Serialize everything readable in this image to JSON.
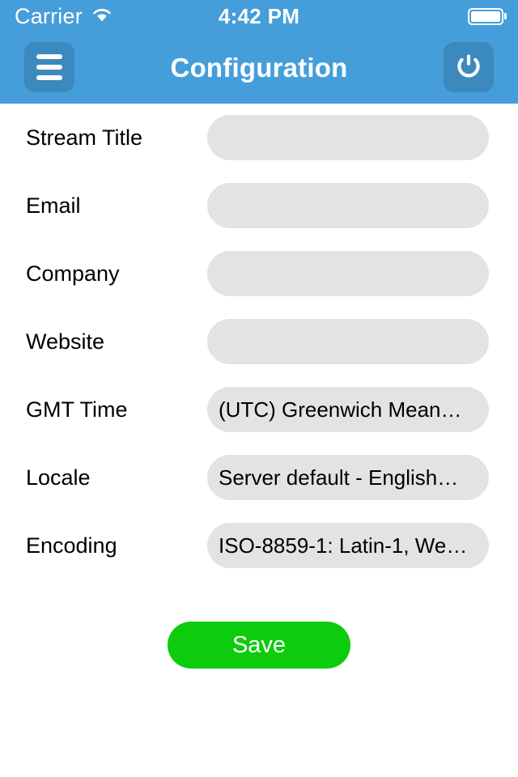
{
  "status_bar": {
    "carrier": "Carrier",
    "wifi_icon": "wifi-icon",
    "time": "4:42 PM",
    "battery_icon": "battery-icon",
    "battery_level_percent": 100
  },
  "nav_bar": {
    "title": "Configuration",
    "menu_icon": "hamburger-menu-icon",
    "power_icon": "power-icon",
    "background_color": "#459ED9",
    "button_color": "#3B89BE"
  },
  "form": {
    "rows": [
      {
        "label": "Stream Title",
        "value": "",
        "type": "text"
      },
      {
        "label": "Email",
        "value": "",
        "type": "text"
      },
      {
        "label": "Company",
        "value": "",
        "type": "text"
      },
      {
        "label": "Website",
        "value": "",
        "type": "text"
      },
      {
        "label": "GMT Time",
        "value": "(UTC) Greenwich Mean…",
        "type": "select"
      },
      {
        "label": "Locale",
        "value": "Server default - English…",
        "type": "select"
      },
      {
        "label": "Encoding",
        "value": "ISO-8859-1: Latin-1, We…",
        "type": "select"
      }
    ],
    "field_background_color": "#E3E3E3"
  },
  "actions": {
    "save_label": "Save",
    "save_color": "#0DCC0D"
  }
}
